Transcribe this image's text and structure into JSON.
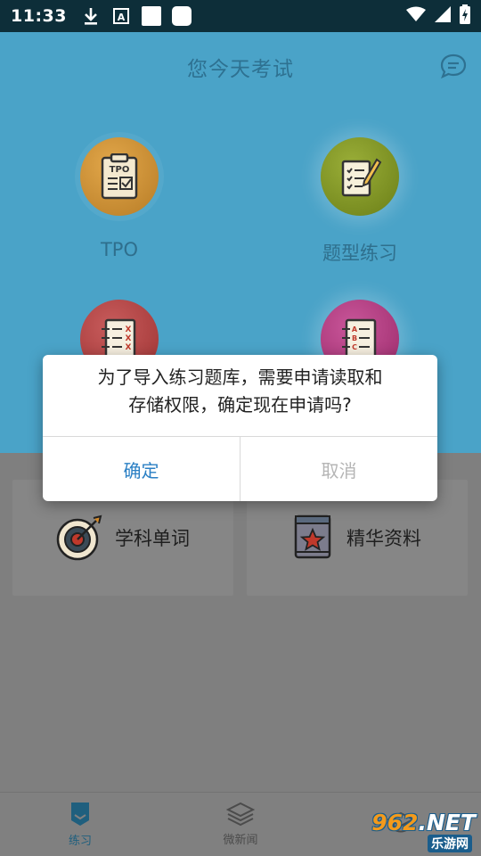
{
  "status_bar": {
    "time": "11:33",
    "icons": [
      "download-icon",
      "font-a-icon",
      "white-square-icon",
      "white-rounded-square-icon",
      "wifi-icon",
      "signal-icon",
      "battery-charging-icon"
    ]
  },
  "header": {
    "title": "您今天考试",
    "right_icon": "chat-bubble-icon"
  },
  "features": [
    {
      "label": "TPO",
      "icon": "tpo-clipboard-icon",
      "badge_text": "TPO"
    },
    {
      "label": "题型练习",
      "icon": "checklist-pencil-icon"
    },
    {
      "label": "",
      "icon": "xxx-list-icon",
      "badge_text": "XXX"
    },
    {
      "label": "",
      "icon": "abc-list-icon",
      "badge_text": "ABC"
    }
  ],
  "cards": [
    {
      "label": "学科单词",
      "icon": "target-icon"
    },
    {
      "label": "精华资料",
      "icon": "book-star-icon"
    }
  ],
  "dialog": {
    "message_line1": "为了导入练习题库，需要申请读取和",
    "message_line2": "存储权限，确定现在申请吗?",
    "confirm_label": "确定",
    "cancel_label": "取消"
  },
  "bottom_nav": [
    {
      "label": "练习",
      "icon": "practice-icon",
      "active": true
    },
    {
      "label": "微新闻",
      "icon": "layers-icon",
      "active": false
    },
    {
      "label": "",
      "icon": "graduation-cap-icon",
      "active": false
    }
  ],
  "watermark": {
    "part1": "962",
    "part2": ".NET",
    "sub": "乐游网"
  },
  "colors": {
    "hero_bg": "#4aa3c8",
    "status_bg": "#0d2e39",
    "lower_bg": "#7f7f7f",
    "confirm_text": "#2a7fc4",
    "cancel_text": "#b5b5b5"
  }
}
